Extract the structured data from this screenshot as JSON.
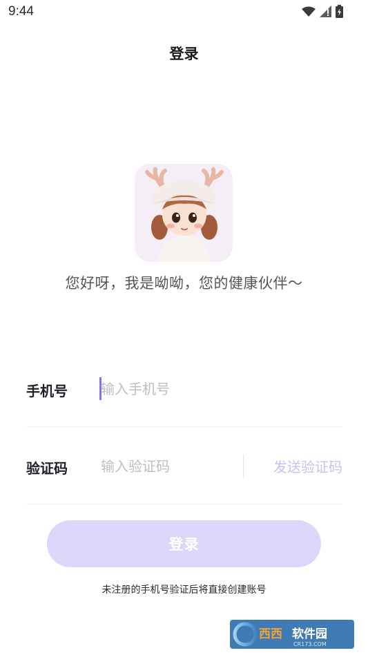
{
  "status_bar": {
    "time": "9:44",
    "icons": [
      "wifi-icon",
      "signal-icon",
      "battery-icon"
    ]
  },
  "header": {
    "title": "登录"
  },
  "welcome": {
    "text": "您好呀，我是呦呦，您的健康伙伴～"
  },
  "form": {
    "phone": {
      "label": "手机号",
      "placeholder": "输入手机号",
      "value": ""
    },
    "code": {
      "label": "验证码",
      "placeholder": "输入验证码",
      "value": "",
      "send_label": "发送验证码"
    }
  },
  "login_button": {
    "label": "登录"
  },
  "register_note": "未注册的手机号验证后将直接创建账号",
  "colors": {
    "accent": "#8a73e0",
    "button_disabled": "#ddd6fb",
    "send_code_disabled": "#c8bff2",
    "placeholder": "#bdbdc4"
  }
}
